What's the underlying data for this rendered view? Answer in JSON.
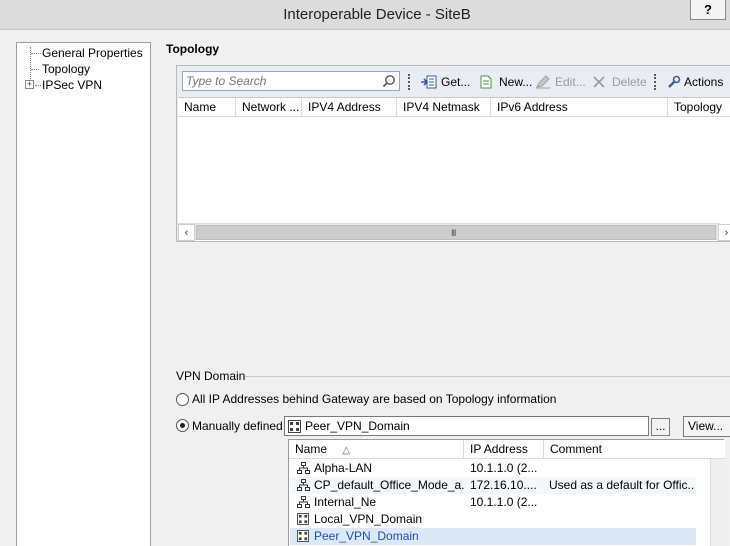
{
  "window": {
    "title": "Interoperable Device - SiteB",
    "help_label": "?"
  },
  "tree": {
    "items": [
      {
        "label": "General Properties"
      },
      {
        "label": "Topology"
      },
      {
        "label": "IPSec VPN",
        "expander": "+"
      }
    ]
  },
  "topology": {
    "heading": "Topology",
    "search_placeholder": "Type to Search",
    "toolbar": {
      "get": "Get...",
      "new": "New...",
      "edit": "Edit...",
      "delete": "Delete",
      "actions": "Actions"
    },
    "columns": [
      "Name",
      "Network ...",
      "IPV4 Address",
      "IPV4 Netmask",
      "IPv6 Address",
      "Topology"
    ],
    "scroll_grip": "III"
  },
  "vpn_domain": {
    "title": "VPN Domain",
    "option_topology": "All IP Addresses behind Gateway are based on Topology information",
    "option_manual": "Manually defined",
    "selected_domain": "Peer_VPN_Domain",
    "dots_label": "...",
    "view_label": "View...",
    "list": {
      "columns": {
        "name": "Name",
        "sort_indicator": "△",
        "ip": "IP Address",
        "comment": "Comment"
      },
      "rows": [
        {
          "name": "Alpha-LAN",
          "ip": "10.1.1.0 (2...",
          "comment": "",
          "icon": "network-icon"
        },
        {
          "name": "CP_default_Office_Mode_a...",
          "ip": "172.16.10....",
          "comment": "Used as a default for Offic...",
          "icon": "network-icon"
        },
        {
          "name": "Internal_Ne",
          "ip": "10.1.1.0 (2...",
          "comment": "",
          "icon": "network-icon"
        },
        {
          "name": "Local_VPN_Domain",
          "ip": "",
          "comment": "",
          "icon": "group-icon"
        },
        {
          "name": "Peer_VPN_Domain",
          "ip": "",
          "comment": "",
          "icon": "group-icon"
        }
      ]
    }
  },
  "colors": {
    "accent": "#1a4fa8",
    "selection": "#dde8f6",
    "toolbar_bg": "#e9edf3"
  }
}
